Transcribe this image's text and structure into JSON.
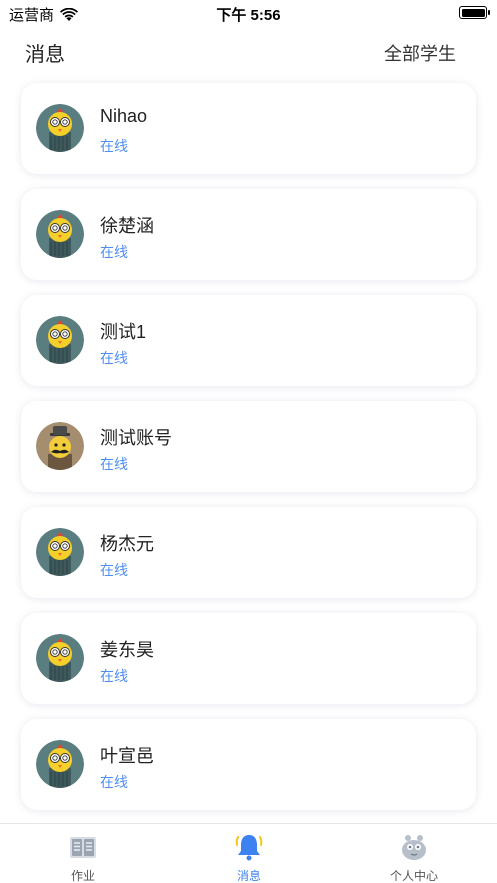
{
  "status_bar": {
    "carrier": "运营商",
    "time": "下午 5:56"
  },
  "nav": {
    "title": "消息",
    "action": "全部学生"
  },
  "messages": [
    {
      "name": "Nihao",
      "status": "在线",
      "avatar": "chick-avatar"
    },
    {
      "name": "徐楚涵",
      "status": "在线",
      "avatar": "chick-avatar"
    },
    {
      "name": "测试1",
      "status": "在线",
      "avatar": "chick-avatar"
    },
    {
      "name": "测试账号",
      "status": "在线",
      "avatar": "gentleman-avatar"
    },
    {
      "name": "杨杰元",
      "status": "在线",
      "avatar": "chick-avatar"
    },
    {
      "name": "姜东昊",
      "status": "在线",
      "avatar": "chick-avatar"
    },
    {
      "name": "叶宣邑",
      "status": "在线",
      "avatar": "chick-avatar"
    }
  ],
  "tabs": [
    {
      "label": "作业",
      "icon": "book-icon",
      "active": false
    },
    {
      "label": "消息",
      "icon": "bell-icon",
      "active": true
    },
    {
      "label": "个人中心",
      "icon": "profile-icon",
      "active": false
    }
  ],
  "colors": {
    "accent": "#3d82f0",
    "status_online": "#4e8ef0",
    "avatar_bg": "#5a7d7f"
  }
}
